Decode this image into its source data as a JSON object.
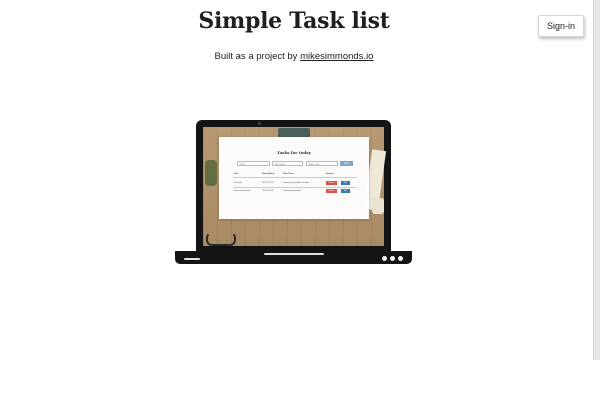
{
  "header": {
    "title": "Simple Task list",
    "subtitle_prefix": "Built as a project by ",
    "subtitle_link": "mikesimmonds.io",
    "signin_label": "Sign-in"
  },
  "laptop_screen": {
    "app_title": "Tasks for today",
    "inputs": [
      "Title",
      "Message",
      "Date due"
    ],
    "add_label": "Add",
    "columns": [
      "Title",
      "Date Added",
      "Date Done",
      "",
      "Actions"
    ],
    "rows": [
      {
        "title": "Do stuff",
        "added": "2017-02-15",
        "done": "Lorem ipsum dolor sit amet",
        "delete": "Delete",
        "update": "Edit"
      },
      {
        "title": "Some other task",
        "added": "2017-02-15",
        "done": "Lorem ipsum dolor",
        "delete": "Delete",
        "update": "Edit"
      }
    ]
  },
  "colors": {
    "delete_button": "#d9534f",
    "update_button": "#337ab7",
    "laptop_body": "#141414"
  }
}
